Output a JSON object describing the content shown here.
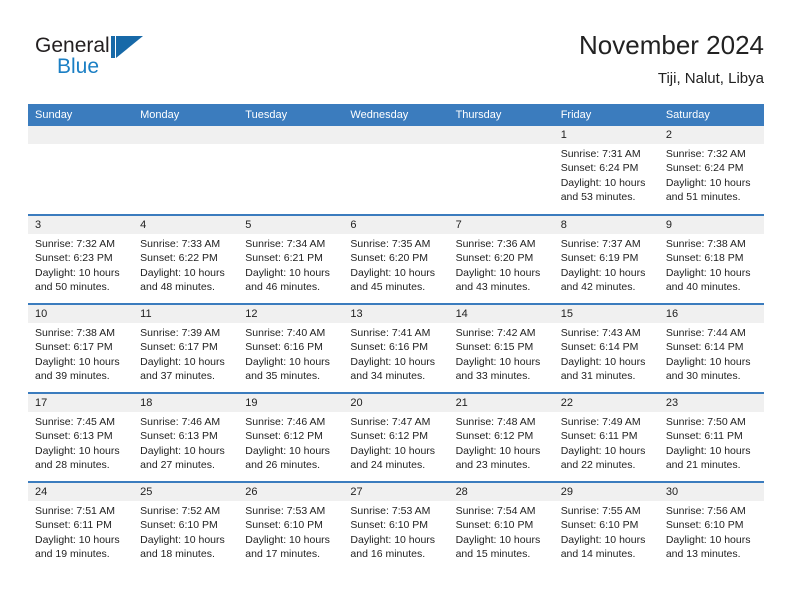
{
  "brand": {
    "name_part1": "General",
    "name_part2": "Blue",
    "mark": "triangle-logo"
  },
  "header": {
    "title": "November 2024",
    "subtitle": "Tiji, Nalut, Libya"
  },
  "colors": {
    "header_blue": "#3b7cbe",
    "brand_blue": "#1b7fc4",
    "daynum_bg": "#f0f0f0",
    "text": "#222222"
  },
  "weekday_headers": [
    "Sunday",
    "Monday",
    "Tuesday",
    "Wednesday",
    "Thursday",
    "Friday",
    "Saturday"
  ],
  "weeks": [
    [
      {
        "day": "",
        "empty": true,
        "sunrise": "",
        "sunset": "",
        "daylight1": "",
        "daylight2": ""
      },
      {
        "day": "",
        "empty": true,
        "sunrise": "",
        "sunset": "",
        "daylight1": "",
        "daylight2": ""
      },
      {
        "day": "",
        "empty": true,
        "sunrise": "",
        "sunset": "",
        "daylight1": "",
        "daylight2": ""
      },
      {
        "day": "",
        "empty": true,
        "sunrise": "",
        "sunset": "",
        "daylight1": "",
        "daylight2": ""
      },
      {
        "day": "",
        "empty": true,
        "sunrise": "",
        "sunset": "",
        "daylight1": "",
        "daylight2": ""
      },
      {
        "day": "1",
        "empty": false,
        "sunrise": "Sunrise: 7:31 AM",
        "sunset": "Sunset: 6:24 PM",
        "daylight1": "Daylight: 10 hours",
        "daylight2": "and 53 minutes."
      },
      {
        "day": "2",
        "empty": false,
        "sunrise": "Sunrise: 7:32 AM",
        "sunset": "Sunset: 6:24 PM",
        "daylight1": "Daylight: 10 hours",
        "daylight2": "and 51 minutes."
      }
    ],
    [
      {
        "day": "3",
        "empty": false,
        "sunrise": "Sunrise: 7:32 AM",
        "sunset": "Sunset: 6:23 PM",
        "daylight1": "Daylight: 10 hours",
        "daylight2": "and 50 minutes."
      },
      {
        "day": "4",
        "empty": false,
        "sunrise": "Sunrise: 7:33 AM",
        "sunset": "Sunset: 6:22 PM",
        "daylight1": "Daylight: 10 hours",
        "daylight2": "and 48 minutes."
      },
      {
        "day": "5",
        "empty": false,
        "sunrise": "Sunrise: 7:34 AM",
        "sunset": "Sunset: 6:21 PM",
        "daylight1": "Daylight: 10 hours",
        "daylight2": "and 46 minutes."
      },
      {
        "day": "6",
        "empty": false,
        "sunrise": "Sunrise: 7:35 AM",
        "sunset": "Sunset: 6:20 PM",
        "daylight1": "Daylight: 10 hours",
        "daylight2": "and 45 minutes."
      },
      {
        "day": "7",
        "empty": false,
        "sunrise": "Sunrise: 7:36 AM",
        "sunset": "Sunset: 6:20 PM",
        "daylight1": "Daylight: 10 hours",
        "daylight2": "and 43 minutes."
      },
      {
        "day": "8",
        "empty": false,
        "sunrise": "Sunrise: 7:37 AM",
        "sunset": "Sunset: 6:19 PM",
        "daylight1": "Daylight: 10 hours",
        "daylight2": "and 42 minutes."
      },
      {
        "day": "9",
        "empty": false,
        "sunrise": "Sunrise: 7:38 AM",
        "sunset": "Sunset: 6:18 PM",
        "daylight1": "Daylight: 10 hours",
        "daylight2": "and 40 minutes."
      }
    ],
    [
      {
        "day": "10",
        "empty": false,
        "sunrise": "Sunrise: 7:38 AM",
        "sunset": "Sunset: 6:17 PM",
        "daylight1": "Daylight: 10 hours",
        "daylight2": "and 39 minutes."
      },
      {
        "day": "11",
        "empty": false,
        "sunrise": "Sunrise: 7:39 AM",
        "sunset": "Sunset: 6:17 PM",
        "daylight1": "Daylight: 10 hours",
        "daylight2": "and 37 minutes."
      },
      {
        "day": "12",
        "empty": false,
        "sunrise": "Sunrise: 7:40 AM",
        "sunset": "Sunset: 6:16 PM",
        "daylight1": "Daylight: 10 hours",
        "daylight2": "and 35 minutes."
      },
      {
        "day": "13",
        "empty": false,
        "sunrise": "Sunrise: 7:41 AM",
        "sunset": "Sunset: 6:16 PM",
        "daylight1": "Daylight: 10 hours",
        "daylight2": "and 34 minutes."
      },
      {
        "day": "14",
        "empty": false,
        "sunrise": "Sunrise: 7:42 AM",
        "sunset": "Sunset: 6:15 PM",
        "daylight1": "Daylight: 10 hours",
        "daylight2": "and 33 minutes."
      },
      {
        "day": "15",
        "empty": false,
        "sunrise": "Sunrise: 7:43 AM",
        "sunset": "Sunset: 6:14 PM",
        "daylight1": "Daylight: 10 hours",
        "daylight2": "and 31 minutes."
      },
      {
        "day": "16",
        "empty": false,
        "sunrise": "Sunrise: 7:44 AM",
        "sunset": "Sunset: 6:14 PM",
        "daylight1": "Daylight: 10 hours",
        "daylight2": "and 30 minutes."
      }
    ],
    [
      {
        "day": "17",
        "empty": false,
        "sunrise": "Sunrise: 7:45 AM",
        "sunset": "Sunset: 6:13 PM",
        "daylight1": "Daylight: 10 hours",
        "daylight2": "and 28 minutes."
      },
      {
        "day": "18",
        "empty": false,
        "sunrise": "Sunrise: 7:46 AM",
        "sunset": "Sunset: 6:13 PM",
        "daylight1": "Daylight: 10 hours",
        "daylight2": "and 27 minutes."
      },
      {
        "day": "19",
        "empty": false,
        "sunrise": "Sunrise: 7:46 AM",
        "sunset": "Sunset: 6:12 PM",
        "daylight1": "Daylight: 10 hours",
        "daylight2": "and 26 minutes."
      },
      {
        "day": "20",
        "empty": false,
        "sunrise": "Sunrise: 7:47 AM",
        "sunset": "Sunset: 6:12 PM",
        "daylight1": "Daylight: 10 hours",
        "daylight2": "and 24 minutes."
      },
      {
        "day": "21",
        "empty": false,
        "sunrise": "Sunrise: 7:48 AM",
        "sunset": "Sunset: 6:12 PM",
        "daylight1": "Daylight: 10 hours",
        "daylight2": "and 23 minutes."
      },
      {
        "day": "22",
        "empty": false,
        "sunrise": "Sunrise: 7:49 AM",
        "sunset": "Sunset: 6:11 PM",
        "daylight1": "Daylight: 10 hours",
        "daylight2": "and 22 minutes."
      },
      {
        "day": "23",
        "empty": false,
        "sunrise": "Sunrise: 7:50 AM",
        "sunset": "Sunset: 6:11 PM",
        "daylight1": "Daylight: 10 hours",
        "daylight2": "and 21 minutes."
      }
    ],
    [
      {
        "day": "24",
        "empty": false,
        "sunrise": "Sunrise: 7:51 AM",
        "sunset": "Sunset: 6:11 PM",
        "daylight1": "Daylight: 10 hours",
        "daylight2": "and 19 minutes."
      },
      {
        "day": "25",
        "empty": false,
        "sunrise": "Sunrise: 7:52 AM",
        "sunset": "Sunset: 6:10 PM",
        "daylight1": "Daylight: 10 hours",
        "daylight2": "and 18 minutes."
      },
      {
        "day": "26",
        "empty": false,
        "sunrise": "Sunrise: 7:53 AM",
        "sunset": "Sunset: 6:10 PM",
        "daylight1": "Daylight: 10 hours",
        "daylight2": "and 17 minutes."
      },
      {
        "day": "27",
        "empty": false,
        "sunrise": "Sunrise: 7:53 AM",
        "sunset": "Sunset: 6:10 PM",
        "daylight1": "Daylight: 10 hours",
        "daylight2": "and 16 minutes."
      },
      {
        "day": "28",
        "empty": false,
        "sunrise": "Sunrise: 7:54 AM",
        "sunset": "Sunset: 6:10 PM",
        "daylight1": "Daylight: 10 hours",
        "daylight2": "and 15 minutes."
      },
      {
        "day": "29",
        "empty": false,
        "sunrise": "Sunrise: 7:55 AM",
        "sunset": "Sunset: 6:10 PM",
        "daylight1": "Daylight: 10 hours",
        "daylight2": "and 14 minutes."
      },
      {
        "day": "30",
        "empty": false,
        "sunrise": "Sunrise: 7:56 AM",
        "sunset": "Sunset: 6:10 PM",
        "daylight1": "Daylight: 10 hours",
        "daylight2": "and 13 minutes."
      }
    ]
  ]
}
